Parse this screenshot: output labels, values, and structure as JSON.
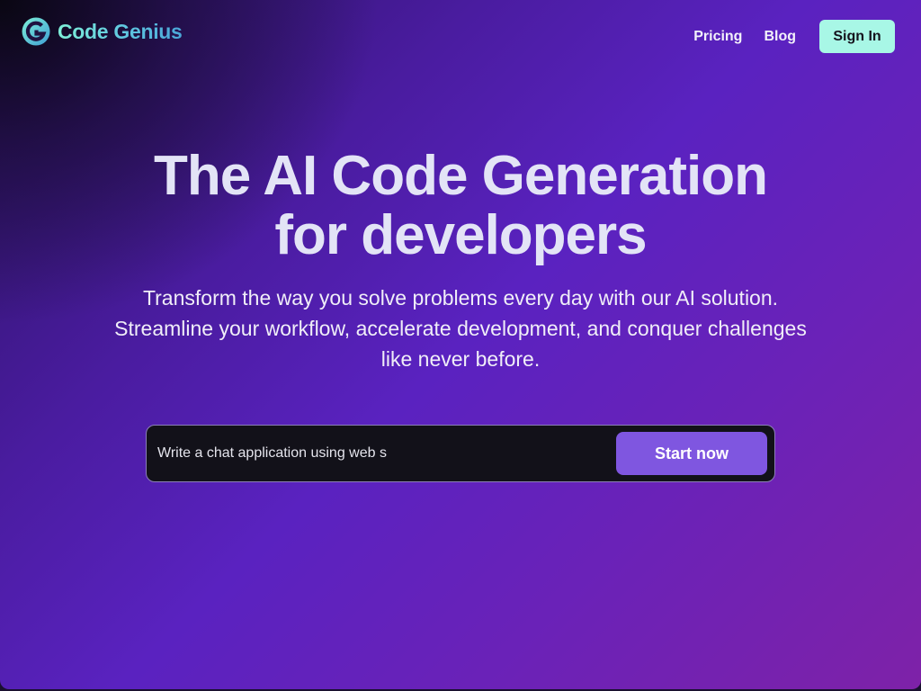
{
  "brand": {
    "name": "Code Genius",
    "logo_icon": "code-genius-logo-icon",
    "gradient_start": "#7ef0d8",
    "gradient_end": "#4aa6d8"
  },
  "nav": {
    "links": [
      "Pricing",
      "Blog"
    ],
    "signin_label": "Sign In",
    "signin_color": "#a8f7e6"
  },
  "hero": {
    "title_line1": "The AI Code Generation",
    "title_line2": "for developers",
    "subtitle_line1": "Transform the way you solve problems every day with our AI solution.",
    "subtitle_line2": "Streamline your workflow, accelerate development, and conquer challenges",
    "subtitle_line3": "like never before."
  },
  "prompt": {
    "value": "Write a chat application using web s",
    "button_label": "Start now",
    "button_color": "#7f56e0"
  },
  "theme": {
    "background_dark": "#0a0812",
    "background_mid": "#5a22c0",
    "background_end": "#7e22a8"
  }
}
